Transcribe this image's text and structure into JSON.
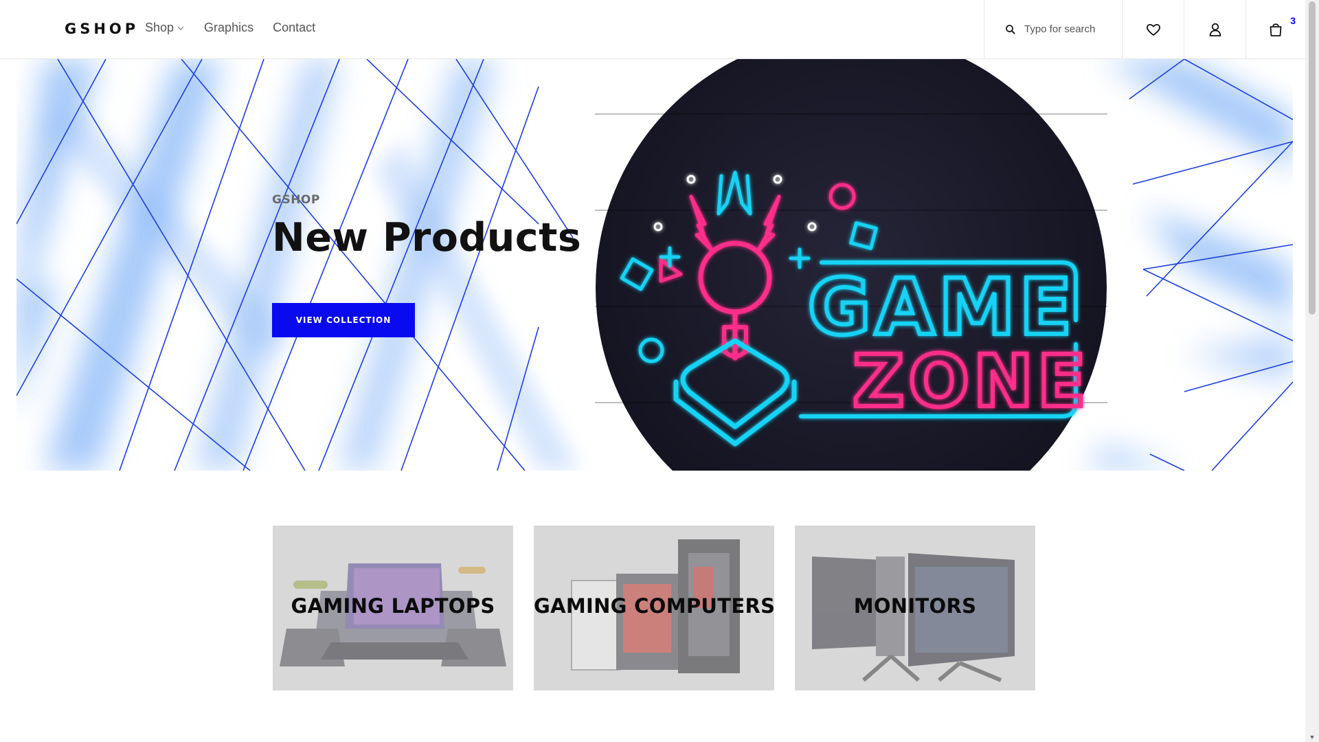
{
  "header": {
    "logo": "GSHOP",
    "nav": [
      {
        "label": "Shop",
        "has_dropdown": true
      },
      {
        "label": "Graphics",
        "has_dropdown": false
      },
      {
        "label": "Contact",
        "has_dropdown": false
      }
    ],
    "search_placeholder": "Typo for search",
    "icons": [
      "search-icon",
      "heart-icon",
      "user-icon",
      "shopping-bag-icon"
    ],
    "cart_count": "3"
  },
  "hero": {
    "eyebrow": "GSHOP",
    "title": "New Products",
    "cta_label": "VIEW COLLECTION",
    "art_text_line1": "GAME",
    "art_text_line2": "ZONE"
  },
  "categories": [
    {
      "label": "GAMING LAPTOPS"
    },
    {
      "label": "GAMING COMPUTERS"
    },
    {
      "label": "MONITORS"
    }
  ],
  "colors": {
    "accent_blue": "#0a0af0",
    "neon_pink": "#ff2e8a",
    "neon_cyan": "#19d3f5",
    "art_bg": "#1b1a2b"
  }
}
